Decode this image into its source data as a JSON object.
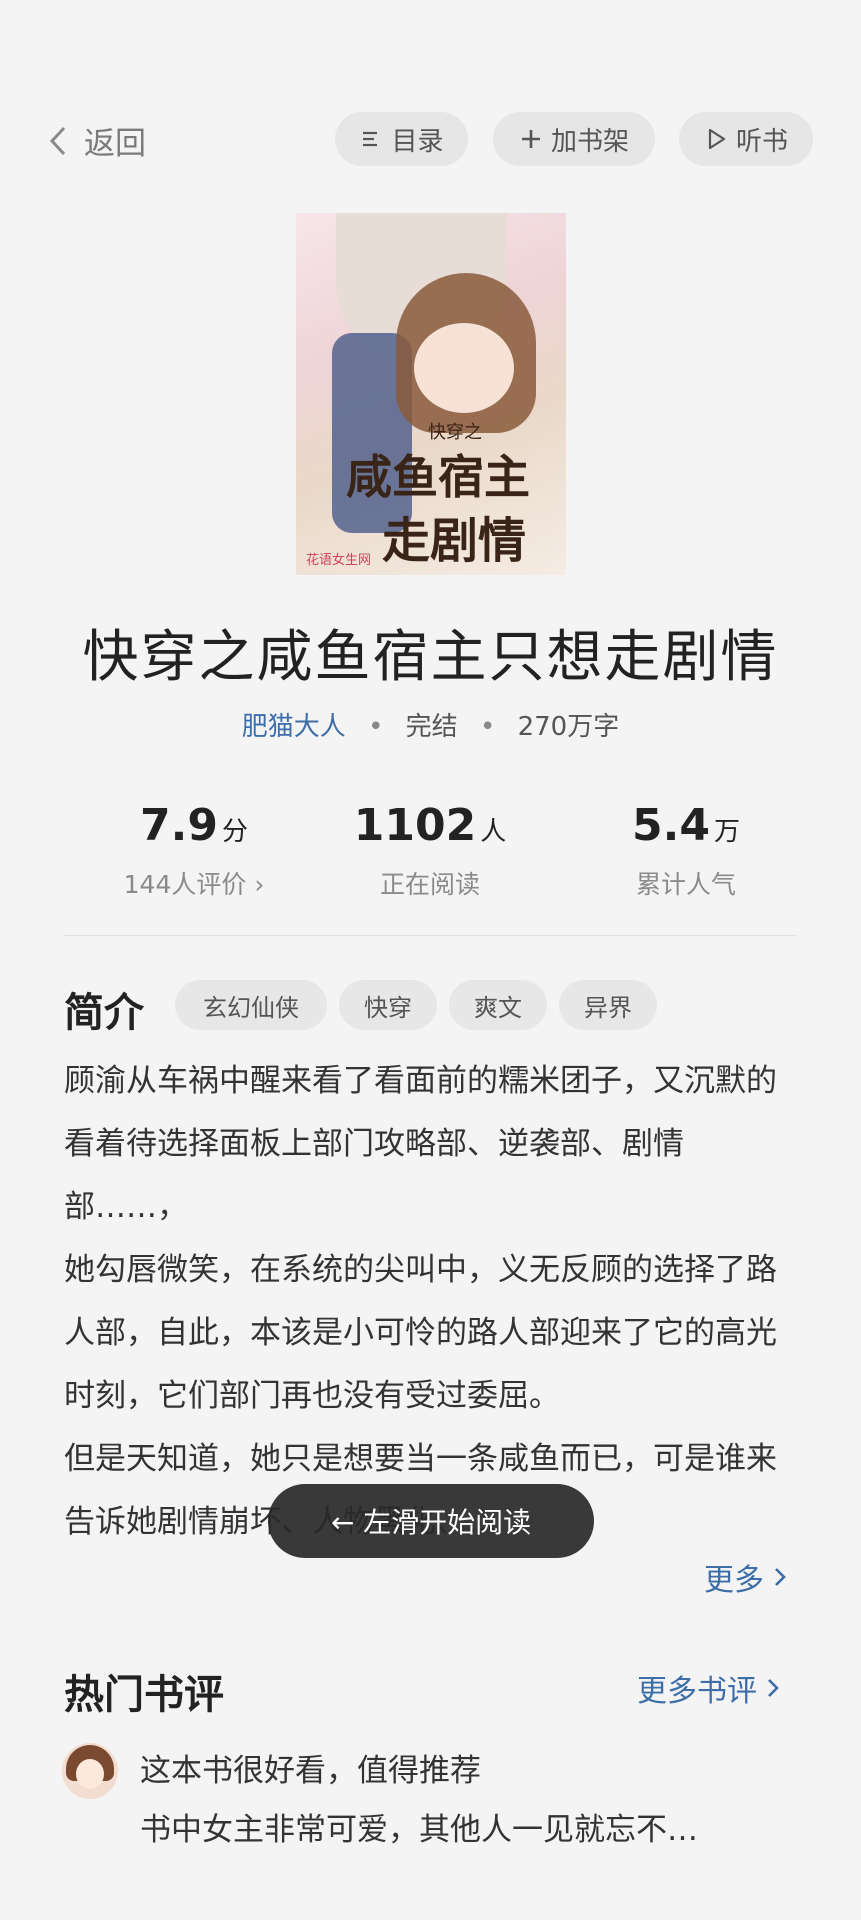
{
  "header": {
    "back_label": "返回",
    "catalog_label": "目录",
    "add_shelf_label": "加书架",
    "listen_label": "听书"
  },
  "cover": {
    "title_line1": "咸鱼宿主",
    "title_line2": "走剧情",
    "subtitle": "快穿之",
    "publisher": "花语女生网"
  },
  "book": {
    "title": "快穿之咸鱼宿主只想走剧情",
    "author": "肥猫大人",
    "separator": "•",
    "status": "完结",
    "word_count": "270万字"
  },
  "stats": [
    {
      "value": "7.9",
      "unit": "分",
      "label": "144人评价 ›"
    },
    {
      "value": "1102",
      "unit": "人",
      "label": "正在阅读"
    },
    {
      "value": "5.4",
      "unit": "万",
      "label": "累计人气"
    }
  ],
  "intro": {
    "heading": "简介",
    "tags": [
      "玄幻仙侠",
      "快穿",
      "爽文",
      "异界"
    ],
    "paragraphs": [
      "顾渝从车祸中醒来看了看面前的糯米团子，又沉默的看着待选择面板上部门攻略部、逆袭部、剧情部……，",
      "她勾唇微笑，在系统的尖叫中，义无反顾的选择了路人部，自此，本该是小可怜的路人部迎来了它的高光时刻，它们部门再也没有受过委屈。",
      "但是天知道，她只是想要当一条咸鱼而已，可是谁来告诉她剧情崩坏、人物黑化、…"
    ],
    "more_label": "更多"
  },
  "toast": "← 左滑开始阅读",
  "reviews": {
    "heading": "热门书评",
    "more_label": "更多书评",
    "items": [
      {
        "title": "这本书很好看，值得推荐",
        "body": "书中女主非常可爱，其他人一见就忘不…"
      }
    ]
  }
}
